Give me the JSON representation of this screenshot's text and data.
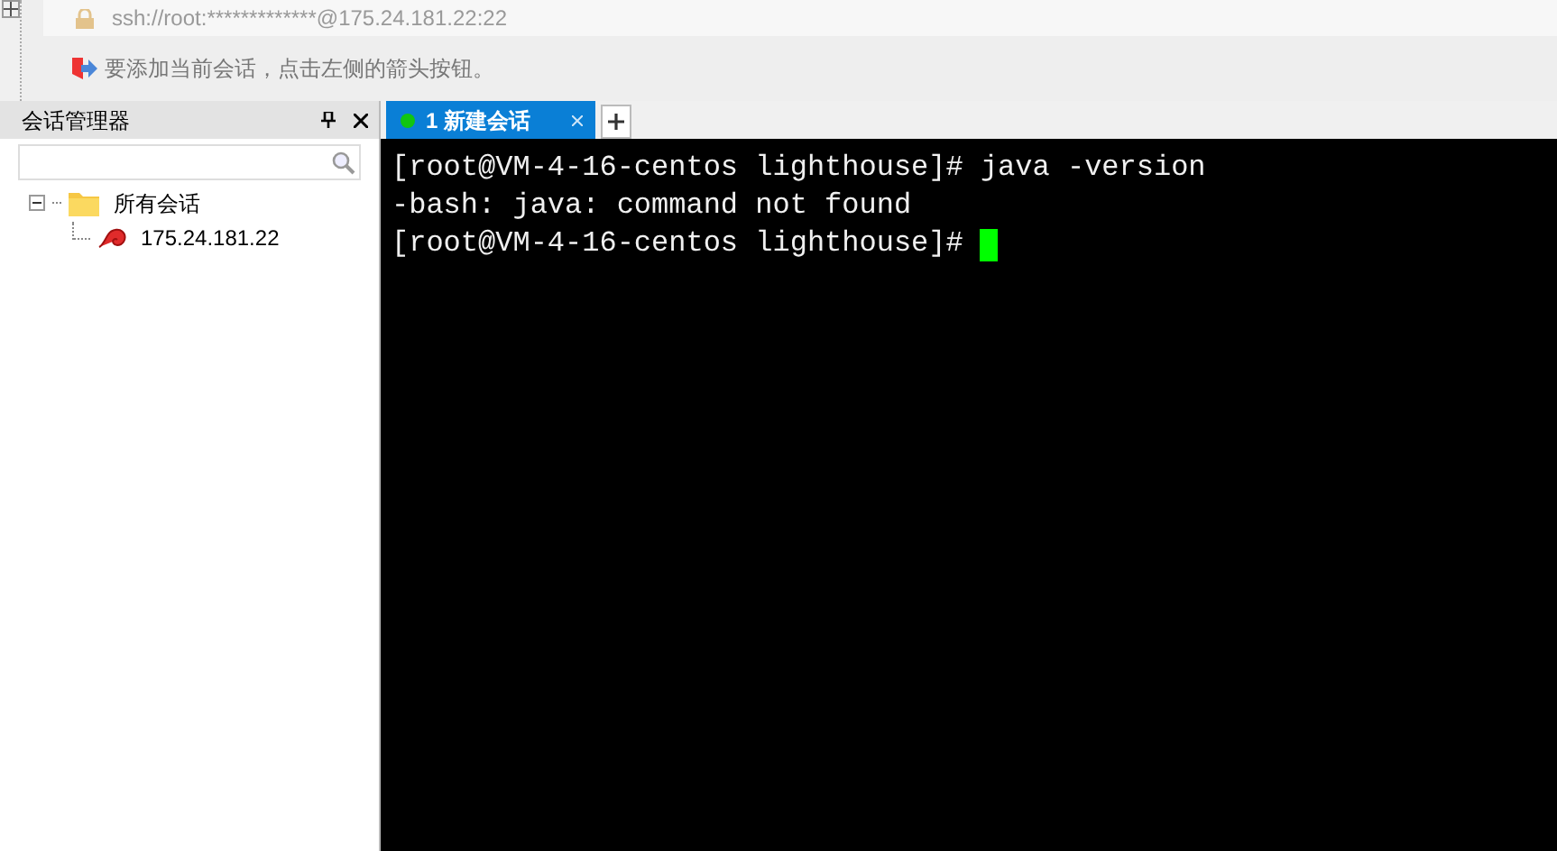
{
  "address_bar": {
    "value": "ssh://root:*************@175.24.181.22:22"
  },
  "hint_bar": {
    "text": "要添加当前会话，点击左侧的箭头按钮。"
  },
  "session_manager": {
    "title": "会话管理器",
    "tree": [
      {
        "label": "所有会话",
        "kind": "folder",
        "expanded": true,
        "children": [
          {
            "label": "175.24.181.22",
            "kind": "session"
          }
        ]
      }
    ]
  },
  "tabs": [
    {
      "label": "1 新建会话",
      "selected": true,
      "connected": true
    }
  ],
  "terminal": {
    "lines": [
      "[root@VM-4-16-centos lighthouse]# java -version",
      "-bash: java: command not found",
      "[root@VM-4-16-centos lighthouse]# "
    ],
    "cursor": true
  }
}
